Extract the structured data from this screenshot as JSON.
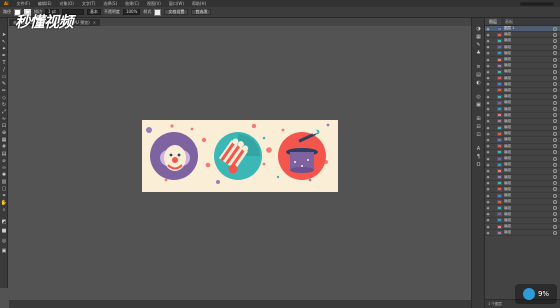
{
  "menubar": {
    "items": [
      "Ai",
      "文件(F)",
      "编辑(E)",
      "对象(O)",
      "文字(T)",
      "选择(S)",
      "效果(C)",
      "视图(V)",
      "窗口(W)",
      "帮助(H)"
    ]
  },
  "controlbar": {
    "selection_label": "路径",
    "stroke_label": "描边",
    "stroke_value": "1 pt",
    "brush_value": "基本",
    "opacity_label": "不透明度",
    "opacity_value": "100%",
    "style_label": "样式",
    "doc_setup": "文档设置",
    "prefs": "首选项"
  },
  "document_tab": {
    "title": "未标题-1.ai* @ 96.82% (RGB/GPU 预览)",
    "close": "×"
  },
  "watermark": "秒懂视频",
  "corner_badge": {
    "percent": "9%"
  },
  "layers_panel": {
    "tabs": [
      "图层",
      "画板"
    ],
    "rows": [
      "图层 1",
      "编组",
      "编组",
      "编组",
      "编组",
      "编组",
      "编组",
      "编组",
      "编组",
      "编组",
      "编组",
      "编组",
      "编组",
      "编组",
      "编组",
      "编组",
      "编组",
      "编组",
      "编组",
      "编组",
      "编组",
      "编组",
      "编组",
      "编组",
      "编组",
      "编组",
      "编组",
      "编组",
      "编组",
      "编组",
      "编组",
      "编组",
      "编组",
      "编组",
      "编组",
      "编组",
      "编组"
    ],
    "footer": "1 个图层"
  },
  "artwork": {
    "background": "#fbeed6",
    "colors": {
      "purple": "#7f62a0",
      "teal": "#3bb8b6",
      "coral": "#f2564c",
      "navy": "#2f3e62",
      "dot_pink": "#f27b76",
      "dot_purple": "#9c7cba"
    },
    "icons": [
      "clown-face",
      "popcorn-box",
      "magic-hat"
    ]
  }
}
